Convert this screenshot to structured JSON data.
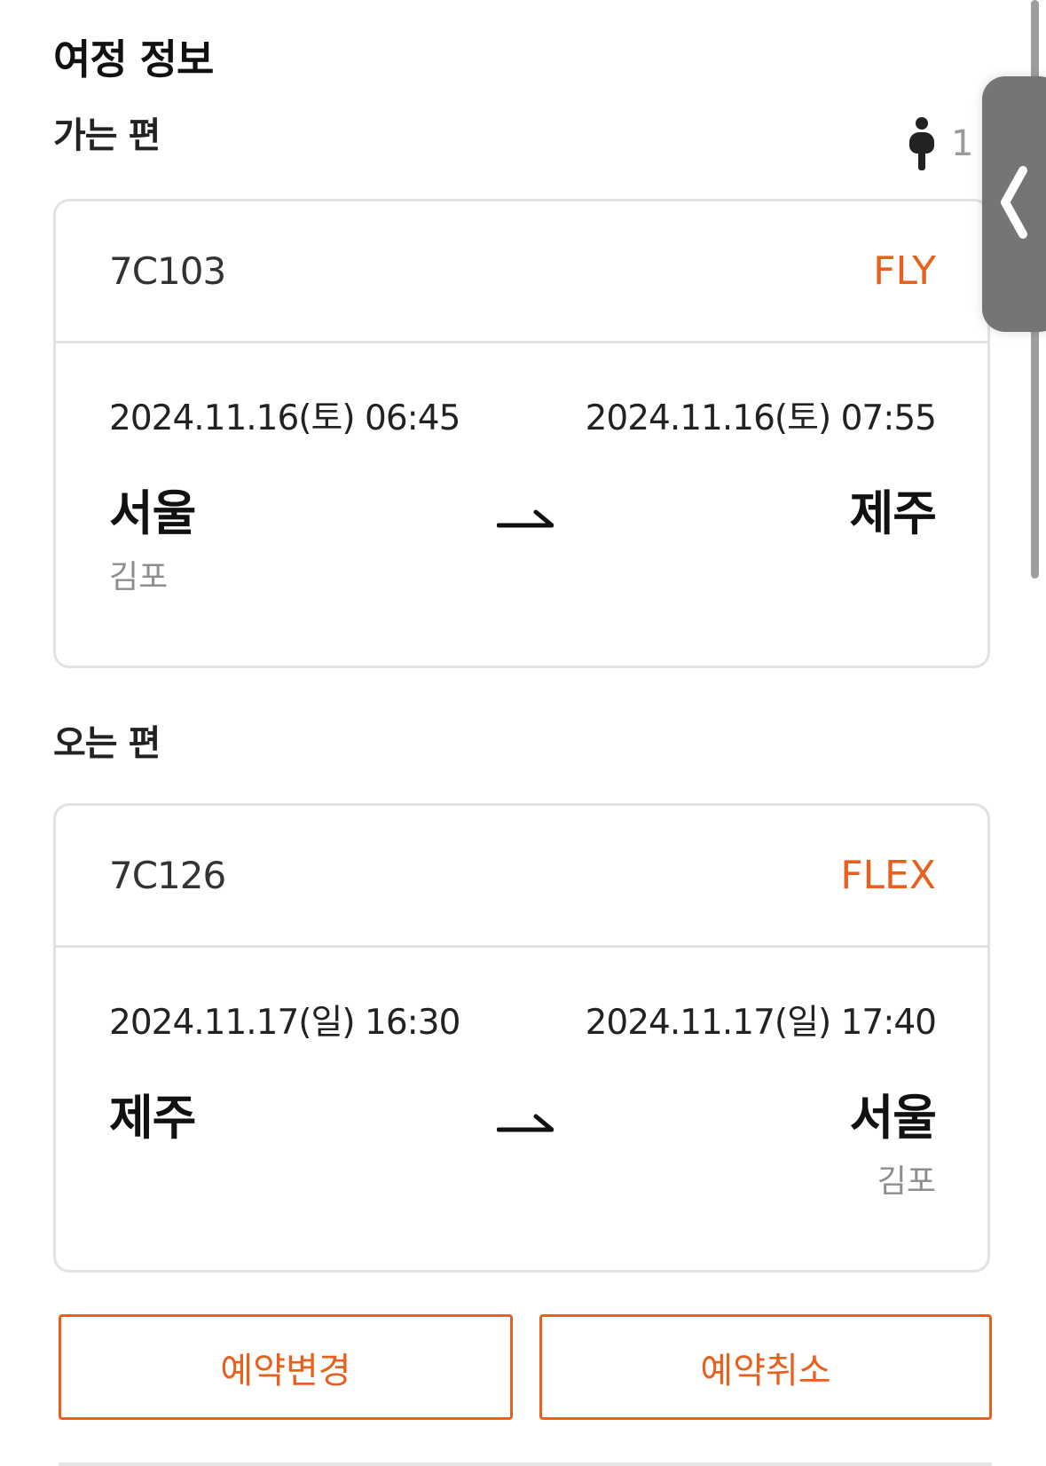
{
  "page": {
    "title": "여정 정보"
  },
  "passengers": {
    "count": "1",
    "icon": "person-icon"
  },
  "outbound": {
    "section_label": "가는 편",
    "flight_number": "7C103",
    "fare_class": "FLY",
    "departure": {
      "datetime": "2024.11.16(토) 06:45",
      "city": "서울",
      "airport": "김포"
    },
    "arrival": {
      "datetime": "2024.11.16(토) 07:55",
      "city": "제주",
      "airport": ""
    }
  },
  "inbound": {
    "section_label": "오는 편",
    "flight_number": "7C126",
    "fare_class": "FLEX",
    "departure": {
      "datetime": "2024.11.17(일) 16:30",
      "city": "제주",
      "airport": ""
    },
    "arrival": {
      "datetime": "2024.11.17(일) 17:40",
      "city": "서울",
      "airport": "김포"
    }
  },
  "actions": {
    "change_label": "예약변경",
    "cancel_label": "예약취소"
  },
  "colors": {
    "accent": "#e8601c",
    "text": "#111111",
    "muted": "#8e8e8e",
    "border": "#e2e2e2"
  }
}
